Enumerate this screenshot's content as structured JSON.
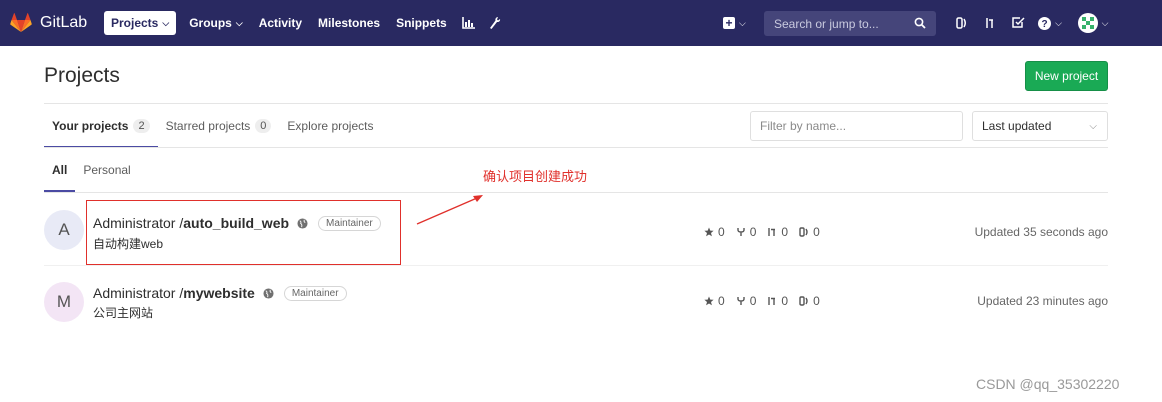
{
  "navbar": {
    "brand": "GitLab",
    "items": [
      {
        "label": "Projects"
      },
      {
        "label": "Groups"
      },
      {
        "label": "Activity"
      },
      {
        "label": "Milestones"
      },
      {
        "label": "Snippets"
      }
    ],
    "search_placeholder": "Search or jump to..."
  },
  "page": {
    "title": "Projects",
    "new_project_label": "New project"
  },
  "tabs": [
    {
      "label": "Your projects",
      "count": "2"
    },
    {
      "label": "Starred projects",
      "count": "0"
    },
    {
      "label": "Explore projects"
    }
  ],
  "filter_placeholder": "Filter by name...",
  "sort_value": "Last updated",
  "subtabs": [
    {
      "label": "All"
    },
    {
      "label": "Personal"
    }
  ],
  "projects": [
    {
      "initial": "A",
      "namespace": "Administrator / ",
      "name": "auto_build_web",
      "role": "Maintainer",
      "description": "自动构建web",
      "stars": "0",
      "forks": "0",
      "merge_requests": "0",
      "issues": "0",
      "updated": "Updated 35 seconds ago",
      "avatar_color": "#e8eaf6"
    },
    {
      "initial": "M",
      "namespace": "Administrator / ",
      "name": "mywebsite",
      "role": "Maintainer",
      "description": "公司主网站",
      "stars": "0",
      "forks": "0",
      "merge_requests": "0",
      "issues": "0",
      "updated": "Updated 23 minutes ago",
      "avatar_color": "#f3e5f5"
    }
  ],
  "annotation": "确认项目创建成功",
  "watermark": "CSDN @qq_35302220",
  "colors": {
    "navbar": "#292961",
    "primary_button": "#1aaa55",
    "annotation": "#e0302b"
  }
}
